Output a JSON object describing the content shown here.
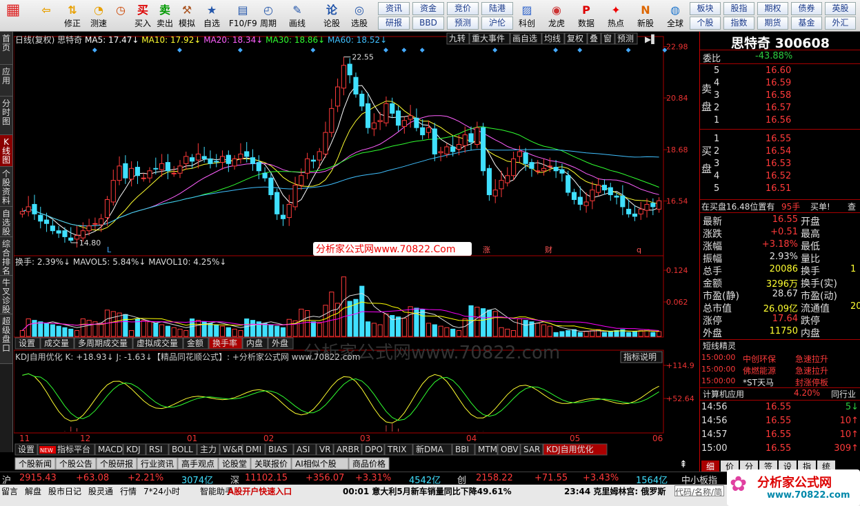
{
  "toolbar": {
    "items": [
      {
        "label": "",
        "icon": "grid-icon"
      },
      {
        "label": "",
        "icon": "back-arrow-icon"
      },
      {
        "label": "修正",
        "icon": "arrow-updown-icon"
      },
      {
        "label": "测速",
        "icon": "speed-icon"
      },
      {
        "label": "",
        "icon": "clock-icon"
      },
      {
        "label": "买入",
        "icon": "buy-icon"
      },
      {
        "label": "卖出",
        "icon": "sell-icon"
      },
      {
        "label": "模拟",
        "icon": "hammer-icon"
      },
      {
        "label": "自选",
        "icon": "star-icon"
      },
      {
        "label": "F10/F9",
        "icon": "f10-icon"
      },
      {
        "label": "周期",
        "icon": "period-icon"
      },
      {
        "label": "画线",
        "icon": "pen-icon"
      },
      {
        "label": "论股",
        "icon": "forum-icon"
      },
      {
        "label": "选股",
        "icon": "select-icon"
      }
    ],
    "buttons": [
      "资讯",
      "资金",
      "竞价",
      "陆港",
      "研报",
      "BBD",
      "预测",
      "沪伦"
    ],
    "items2": [
      {
        "label": "科创"
      },
      {
        "label": "龙虎"
      },
      {
        "label": "数据"
      },
      {
        "label": "热点"
      },
      {
        "label": "新股"
      },
      {
        "label": "全球"
      }
    ],
    "buttons2": [
      "板块",
      "股指",
      "期权",
      "债券",
      "英股",
      "个股",
      "指数",
      "期货",
      "基金",
      "外汇"
    ]
  },
  "leftnav": [
    "首页",
    "应用",
    "分时图",
    "K线图",
    "个股资料",
    "自选股",
    "综合排名",
    "牛叉诊股",
    "超级盘口"
  ],
  "kline": {
    "header_left": "日线(复权) 思特奇",
    "ma5": "MA5: 17.47↓",
    "ma10": "MA10: 17.92↓",
    "ma20": "MA20: 18.34↓",
    "ma30": "MA30: 18.86↓",
    "ma60": "MA60: 18.52↓",
    "tools": [
      "九转",
      "重大事件",
      "画自选",
      "均线",
      "复权",
      "叠",
      "窗",
      "预测"
    ],
    "yticks": [
      "22.98",
      "20.84",
      "18.68",
      "16.54"
    ],
    "hi_label": "22.55",
    "lo_label": "14.80",
    "watermark": "分析家公式网www.70822.Com",
    "marks": [
      "L",
      "涨",
      "财",
      "q"
    ]
  },
  "vol": {
    "header": "换手: 2.39%↓ MAVOL5: 5.84%↓ MAVOL10: 4.25%↓",
    "yticks": [
      "0.124",
      "0.062"
    ],
    "tabs": [
      "设置",
      "成交量",
      "多周期成交量",
      "虚拟成交量",
      "金额",
      "换手率",
      "内盘",
      "外盘"
    ]
  },
  "kdj": {
    "header": "KDJ自用优化 K: +18.93↓ J: -1.63↓【精品同花顺公式】: +分析家公式网 www.70822.com",
    "explain": "指标说明",
    "yticks": [
      "+114.9",
      "+52.64"
    ],
    "xticks": [
      "11",
      "12",
      "01",
      "02",
      "03",
      "04",
      "05",
      "06"
    ]
  },
  "indtabs": [
    "设置",
    "指标平台",
    "MACD",
    "KDJ",
    "RSI",
    "BOLL",
    "主力",
    "W&R",
    "DMI",
    "BIAS",
    "ASI",
    "VR",
    "ARBR",
    "DPO",
    "TRIX",
    "新DMA",
    "BBI",
    "MTM",
    "OBV",
    "SAR",
    "KDJ自用优化"
  ],
  "newbadge": "NEW",
  "infotabs": [
    "个股新闻",
    "个股公告",
    "个股研报",
    "行业资讯",
    "高手观点",
    "论股堂",
    "关联报价",
    "AI相似个股",
    "商品价格"
  ],
  "right": {
    "name": "思特奇 300608",
    "weibi_label": "委比",
    "weibi": "-43.88%",
    "sell_label": "卖盘",
    "sells": [
      [
        "5",
        "16.60"
      ],
      [
        "4",
        "16.59"
      ],
      [
        "3",
        "16.58"
      ],
      [
        "2",
        "16.57"
      ],
      [
        "1",
        "16.56"
      ]
    ],
    "buy_label": "买盘",
    "buys": [
      [
        "1",
        "16.55"
      ],
      [
        "2",
        "16.54"
      ],
      [
        "3",
        "16.53"
      ],
      [
        "4",
        "16.52"
      ],
      [
        "5",
        "16.51"
      ]
    ],
    "inbuy": "在买盘16.48位置有",
    "inbuy_qty": "95手",
    "inbuy_act": "买单!",
    "inbuy_more": "查",
    "quote": [
      [
        "最新",
        "16.55",
        "开盘",
        ""
      ],
      [
        "涨跌",
        "+0.51",
        "最高",
        ""
      ],
      [
        "涨幅",
        "+3.18%",
        "最低",
        ""
      ],
      [
        "振幅",
        "2.93%",
        "量比",
        ""
      ],
      [
        "总手",
        "20086",
        "换手",
        "1"
      ],
      [
        "金额",
        "3296万",
        "换手(实)",
        ""
      ],
      [
        "市盈(静)",
        "28.67",
        "市盈(动)",
        ""
      ],
      [
        "总市值",
        "26.09亿",
        "流通值",
        "20"
      ],
      [
        "涨停",
        "17.64",
        "跌停",
        ""
      ],
      [
        "外盘",
        "11750",
        "内盘",
        ""
      ]
    ],
    "jingling_title": "短线精灵",
    "jingling": [
      [
        "15:00:00",
        "中创环保",
        "急速拉升"
      ],
      [
        "15:00:00",
        "佛燃能源",
        "急速拉升"
      ],
      [
        "15:00:00",
        "*ST天马",
        "封涨停板"
      ]
    ],
    "calc_label": "计算机应用",
    "calc_pct": "4.20%",
    "calc_more": "同行业",
    "ticks": [
      [
        "14:56",
        "16.55",
        "5↓"
      ],
      [
        "14:56",
        "16.55",
        "10↑"
      ],
      [
        "14:57",
        "16.55",
        "10↑"
      ],
      [
        "15:00",
        "16.55",
        "309↑"
      ]
    ],
    "btabs": [
      "细",
      "价",
      "分",
      "签",
      "设",
      "指",
      "统"
    ]
  },
  "status": {
    "sh_label": "沪",
    "sh": "2915.43",
    "sh_chg": "+63.08",
    "sh_pct": "+2.21%",
    "sh_amt": "3074亿",
    "sz_label": "深",
    "sz": "11102.15",
    "sz_chg": "+356.07",
    "sz_pct": "+3.31%",
    "sz_amt": "4542亿",
    "cy_label": "创",
    "cy": "2158.22",
    "cy_chg": "+71.55",
    "cy_pct": "+3.43%",
    "cy_amt": "1564亿",
    "zxb": "中小板指"
  },
  "status2": {
    "items": [
      "留言",
      "解盘",
      "股市日记",
      "股灵通",
      "行情",
      "7*24小时",
      "智能助手"
    ],
    "open": "A股开户快速入口",
    "news1": "00:01 意大利5月新车销量同比下降49.61%",
    "news2": "23:44 克里姆林宫: 俄罗斯",
    "search": "代码/名称/简",
    "logo": "分析家公式网",
    "logo_url": "www.70822.com"
  },
  "colors": {
    "up": "#ff3a3a",
    "down": "#40e0ff",
    "ma5": "#ffffff",
    "ma10": "#ffff30",
    "ma20": "#ff60ff",
    "ma30": "#30ff30",
    "ma60": "#40c0ff"
  }
}
